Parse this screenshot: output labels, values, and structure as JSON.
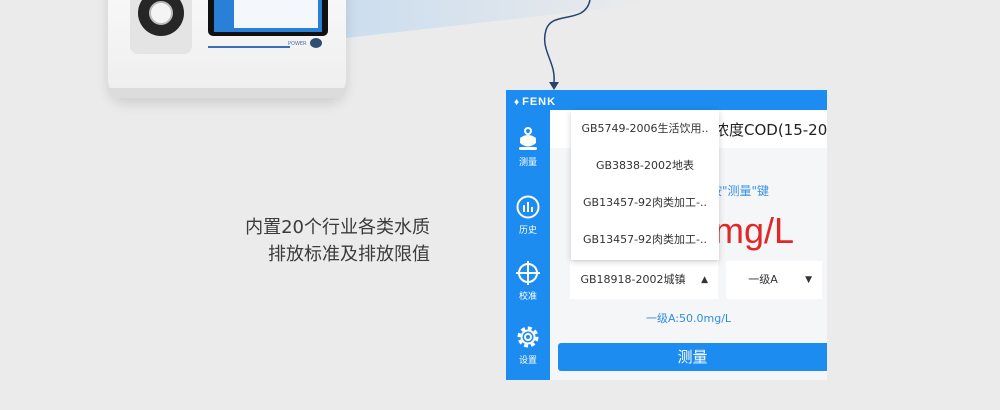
{
  "caption": {
    "line1": "内置20个行业各类水质",
    "line2": "排放标准及排放限值"
  },
  "device": {
    "power_label": "POWER"
  },
  "app": {
    "brand": "FENK",
    "nav": [
      {
        "label": "测量",
        "icon": "flask-icon"
      },
      {
        "label": "历史",
        "icon": "history-icon"
      },
      {
        "label": "校准",
        "icon": "crosshair-icon"
      },
      {
        "label": "设置",
        "icon": "gear-icon"
      }
    ],
    "title": "浓度COD(15-20",
    "hint": "按\"测量\"键",
    "result": "mg/L",
    "standard_select": {
      "value": "GB18918-2002城镇",
      "arrow": "▲"
    },
    "grade_select": {
      "value": "一级A",
      "arrow": "▼"
    },
    "dropdown_options": [
      "GB5749-2006生活饮用..",
      "GB3838-2002地表",
      "GB13457-92肉类加工-..",
      "GB13457-92肉类加工-.."
    ],
    "limit": "一级A:50.0mg/L",
    "measure_button": "测量"
  },
  "colors": {
    "brand_blue": "#1c8cf0",
    "result_red": "#e22727",
    "arrow_navy": "#24446f"
  }
}
